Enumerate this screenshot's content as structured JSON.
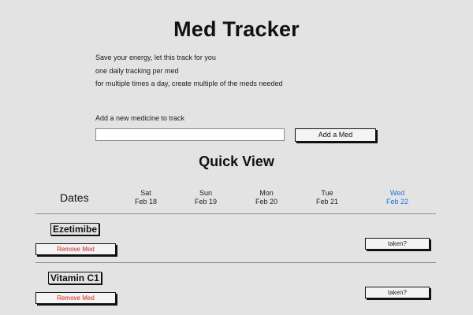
{
  "app": {
    "title": "Med Tracker"
  },
  "intro": [
    "Save your energy, let this track for you",
    "one daily tracking per med",
    "for multiple times a day, create multiple of the meds needed"
  ],
  "add_med": {
    "label": "Add a new medicine to track",
    "input_value": "",
    "button_label": "Add a Med"
  },
  "quick_view": {
    "title": "Quick View",
    "dates_label": "Dates",
    "days": [
      {
        "dow": "Sat",
        "date": "Feb 18",
        "today": false
      },
      {
        "dow": "Sun",
        "date": "Feb 19",
        "today": false
      },
      {
        "dow": "Mon",
        "date": "Feb 20",
        "today": false
      },
      {
        "dow": "Tue",
        "date": "Feb 21",
        "today": false
      },
      {
        "dow": "Wed",
        "date": "Feb 22",
        "today": true
      }
    ],
    "today_color": "#1a73d9",
    "meds": [
      {
        "name": "Ezetimibe",
        "remove_label": "Remove Med",
        "taken_label": "taken?"
      },
      {
        "name": "Vitamin C1",
        "remove_label": "Remove Med",
        "taken_label": "taken?"
      }
    ]
  }
}
